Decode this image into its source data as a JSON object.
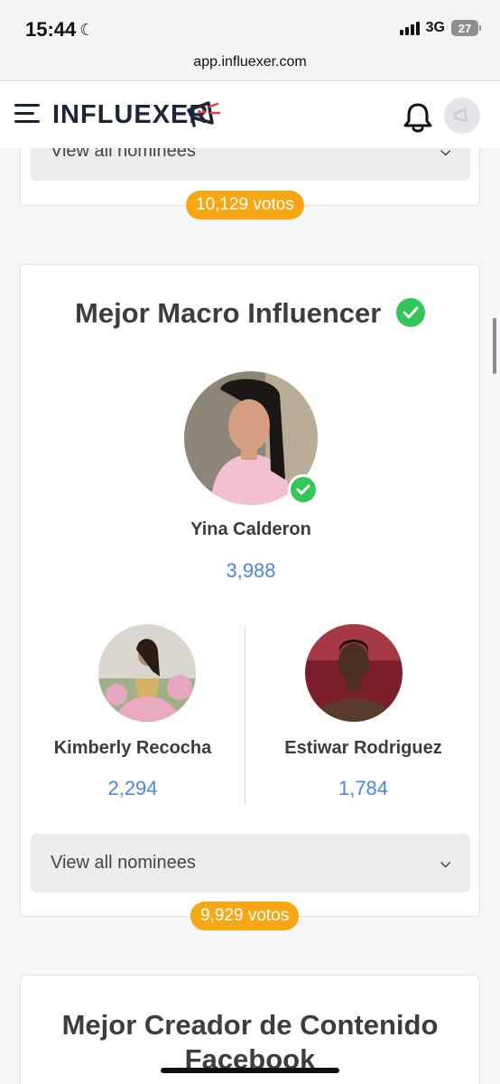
{
  "status_bar": {
    "time": "15:44",
    "network": "3G",
    "battery": "27"
  },
  "browser": {
    "url": "app.influexer.com"
  },
  "header": {
    "logo": "INFLUEXER",
    "menu_icon": "hamburger-icon",
    "notification_icon": "bell-icon"
  },
  "previous_category": {
    "view_all_label": "View all nominees",
    "votes": "10,129 votos"
  },
  "category": {
    "title": "Mejor Macro Influencer",
    "winner": {
      "name": "Yina Calderon",
      "votes": "3,988"
    },
    "runners_up": [
      {
        "name": "Kimberly Recocha",
        "votes": "2,294"
      },
      {
        "name": "Estiwar Rodriguez",
        "votes": "1,784"
      }
    ],
    "view_all_label": "View all nominees",
    "total_votes": "9,929 votos"
  },
  "next_category": {
    "title": "Mejor Creador de Contenido Facebook"
  },
  "colors": {
    "accent_orange": "#f7a614",
    "vote_blue": "#4a86e0",
    "check_green": "#33c759"
  }
}
